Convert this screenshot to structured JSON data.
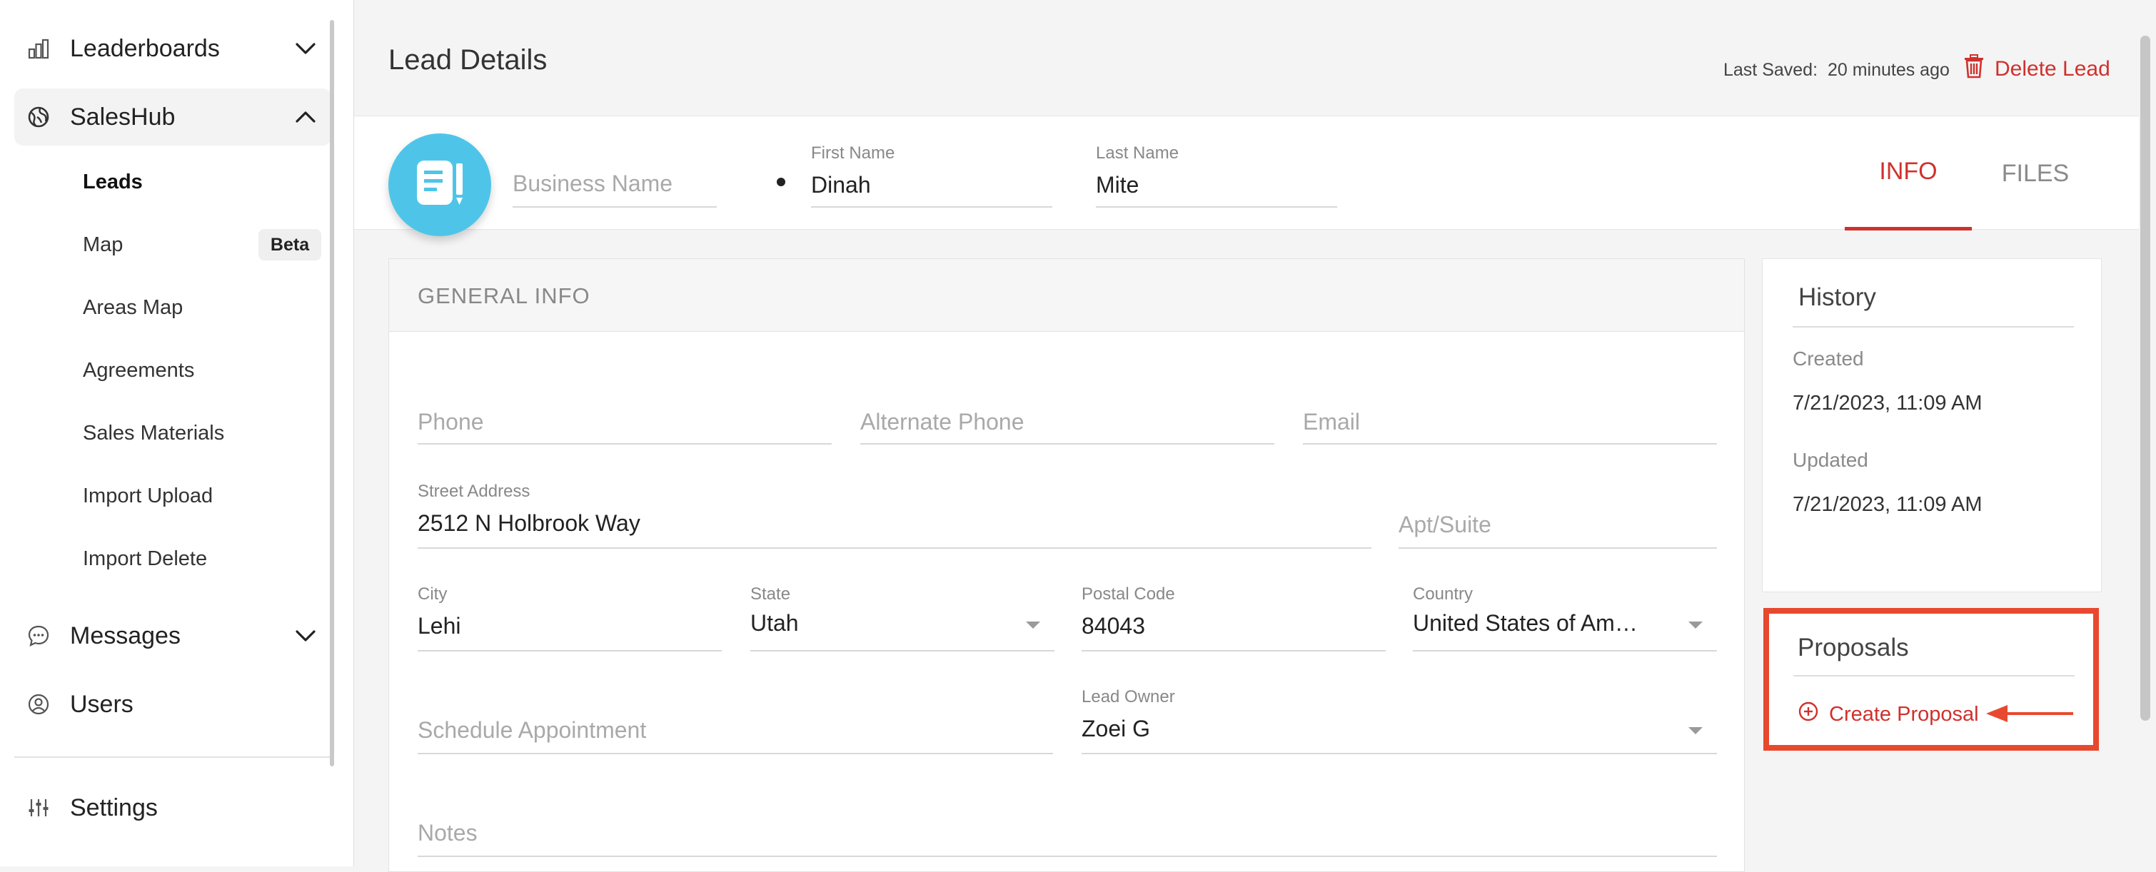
{
  "sidebar": {
    "items": [
      {
        "label": "Leaderboards",
        "icon": "bar-chart-icon"
      },
      {
        "label": "SalesHub",
        "icon": "globe-icon"
      },
      {
        "label": "Messages",
        "icon": "chat-icon"
      },
      {
        "label": "Users",
        "icon": "user-circle-icon"
      },
      {
        "label": "Settings",
        "icon": "sliders-icon"
      }
    ],
    "saleshub_sub": [
      {
        "label": "Leads"
      },
      {
        "label": "Map"
      },
      {
        "label": "Areas Map"
      },
      {
        "label": "Agreements"
      },
      {
        "label": "Sales Materials"
      },
      {
        "label": "Import Upload"
      },
      {
        "label": "Import Delete"
      }
    ],
    "beta_badge": "Beta"
  },
  "header": {
    "title": "Lead Details",
    "last_saved_label": "Last Saved:",
    "last_saved_value": "20 minutes ago",
    "delete_label": "Delete Lead"
  },
  "lead": {
    "business_name_placeholder": "Business Name",
    "first_name_label": "First Name",
    "first_name": "Dinah",
    "last_name_label": "Last Name",
    "last_name": "Mite"
  },
  "tabs": [
    {
      "label": "INFO",
      "active": true
    },
    {
      "label": "FILES",
      "active": false
    }
  ],
  "general": {
    "title": "GENERAL INFO",
    "phone_placeholder": "Phone",
    "alt_phone_placeholder": "Alternate Phone",
    "email_placeholder": "Email",
    "street_label": "Street Address",
    "street": "2512 N Holbrook Way",
    "apt_placeholder": "Apt/Suite",
    "city_label": "City",
    "city": "Lehi",
    "state_label": "State",
    "state": "Utah",
    "postal_label": "Postal Code",
    "postal": "84043",
    "country_label": "Country",
    "country": "United States of Am…",
    "schedule_placeholder": "Schedule Appointment",
    "owner_label": "Lead Owner",
    "owner": "Zoei G",
    "notes_placeholder": "Notes"
  },
  "history": {
    "title": "History",
    "created_label": "Created",
    "created": "7/21/2023, 11:09 AM",
    "updated_label": "Updated",
    "updated": "7/21/2023, 11:09 AM"
  },
  "proposals": {
    "title": "Proposals",
    "create_label": "Create Proposal"
  },
  "colors": {
    "accent": "#d0312d",
    "highlight": "#e8492e",
    "avatar": "#4ec5e8"
  }
}
